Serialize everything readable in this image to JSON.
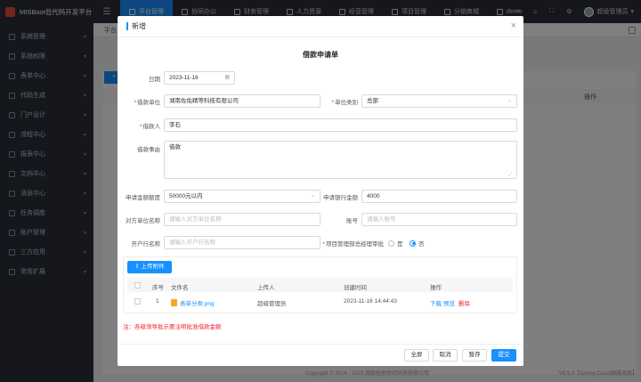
{
  "app": {
    "title": "MISBoot低代码开发平台"
  },
  "topnav": {
    "items": [
      "平台管理",
      "协同办公",
      "财务管理",
      "人力资源",
      "经营管理",
      "项目管理",
      "分销商城",
      "demo"
    ],
    "user": "超级管理员"
  },
  "sidebar": {
    "items": [
      "系统管理",
      "系统权限",
      "表单中心",
      "代码生成",
      "门户设计",
      "流程中心",
      "报表中心",
      "文档中心",
      "消息中心",
      "任务调度",
      "账户管理",
      "三方应用",
      "常用扩展"
    ]
  },
  "background": {
    "tab": "平台",
    "add_label": "+",
    "op_header": "操作",
    "footer": "Copyright © 2014 - 2023 湖南佐佑时代科技有限公司",
    "version": "V5.5.0【Spring Cloud微服务版】"
  },
  "dialog": {
    "title": "新增",
    "close": "×",
    "form_title": "借款申请单",
    "fields": {
      "date_label": "日期",
      "date_value": "2023-11-16",
      "unit_label": "借款单位",
      "unit_value": "湖南佐佑精等科技有限公司",
      "unit_type_label": "单位类别",
      "unit_type_value": "总部",
      "borrower_label": "借款人",
      "borrower_value": "李石",
      "reason_label": "借款事由",
      "reason_value": "借款",
      "amount_label": "申请金额额度",
      "amount_value": "50000元以内",
      "bank_amount_label": "申请银行金额",
      "bank_amount_value": "4000",
      "counterparty_label": "对方单位名称",
      "counterparty_placeholder": "请输入对方单位名称",
      "account_label": "账号",
      "account_placeholder": "请输入账号",
      "bank_label": "开户行名称",
      "bank_placeholder": "请输入开户行名称",
      "approval_label": "项目管理部总经理审批",
      "approval_yes": "是",
      "approval_no": "否"
    },
    "attachments": {
      "upload_label": "上传附件",
      "columns": [
        "序号",
        "文件名",
        "上传人",
        "创建时间",
        "操作"
      ],
      "rows": [
        {
          "index": "1",
          "filename": "表单分类.png",
          "uploader": "超级管理员",
          "created": "2023-11-16 14:44:43",
          "download": "下载",
          "preview": "预览",
          "delete": "删除"
        }
      ]
    },
    "note": "注：各级领导批示要注明批准借款金额",
    "buttons": {
      "fullscreen": "全屏",
      "cancel": "取消",
      "save_draft": "暂存",
      "submit": "提交"
    }
  },
  "colors": {
    "primary": "#1890ff",
    "danger": "#f5222d",
    "nav_bg": "#2b2f3a"
  }
}
